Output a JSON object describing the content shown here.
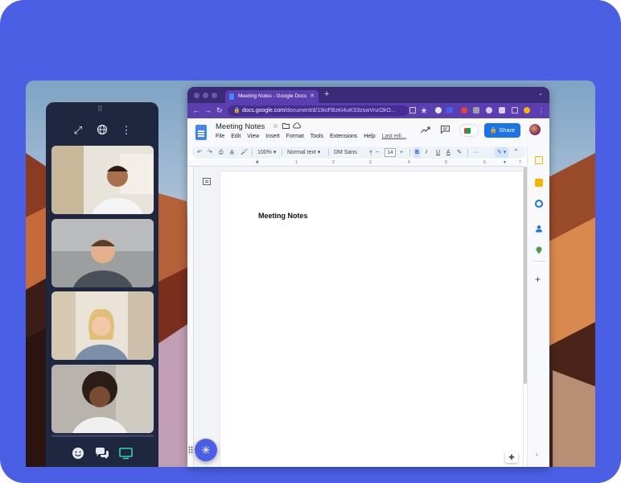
{
  "browser": {
    "tab_title": "Meeting Notes - Google Docs",
    "tab_close": "✕",
    "new_tab": "+",
    "url_host": "docs.google.com",
    "url_path": "/document/d/19ioFBzKi4uKS3zswVnzOkO...",
    "nav_back": "←",
    "nav_forward": "→",
    "nav_reload": "↻"
  },
  "docs": {
    "title": "Meeting Notes",
    "menu": [
      "File",
      "Edit",
      "View",
      "Insert",
      "Format",
      "Tools",
      "Extensions",
      "Help"
    ],
    "last_edit": "Last edi...",
    "share_label": "Share",
    "toolbar": {
      "zoom": "100%",
      "style": "Normal text",
      "font": "DM Sans",
      "font_size": "14",
      "bold": "B",
      "italic": "I",
      "underline": "U",
      "text_color": "A",
      "more": "···",
      "minus": "−",
      "plus": "+"
    },
    "ruler_numbers": [
      "1",
      "1",
      "2",
      "3",
      "4",
      "5",
      "6",
      "7"
    ],
    "page_heading": "Meeting Notes"
  },
  "video_panel": {
    "handle": "⠿"
  },
  "colors": {
    "brand": "#4a5fe3",
    "panel": "#1f2640",
    "browser_purple": "#5b3fb0",
    "share_blue": "#1a73e8"
  }
}
